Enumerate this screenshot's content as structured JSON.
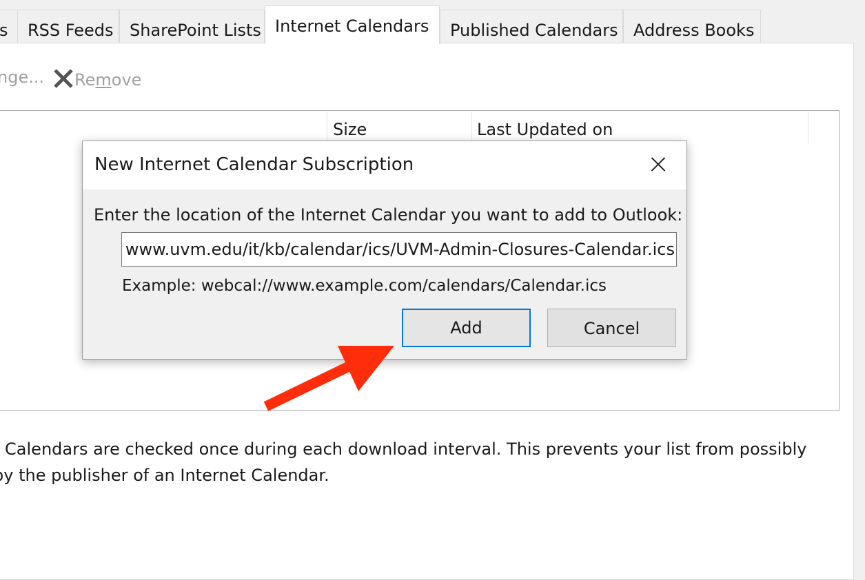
{
  "tabs": [
    {
      "label": "s"
    },
    {
      "label": "RSS Feeds"
    },
    {
      "label": "SharePoint Lists"
    },
    {
      "label": "Internet Calendars"
    },
    {
      "label": "Published Calendars"
    },
    {
      "label": "Address Books"
    }
  ],
  "toolbar": {
    "change_label": "nge...",
    "remove_label_pre": "Re",
    "remove_label_u": "m",
    "remove_label_post": "ove",
    "remove_icon": "x-icon"
  },
  "list": {
    "columns": [
      "Size",
      "Last Updated on"
    ]
  },
  "info_text": {
    "line1": "t Calendars are checked once during each download interval. This prevents your list from possibly",
    "line2": "by the publisher of an Internet Calendar."
  },
  "dialog": {
    "title": "New Internet Calendar Subscription",
    "prompt": "Enter the location of the Internet Calendar you want to add to Outlook:",
    "input_value": "www.uvm.edu/it/kb/calendar/ics/UVM-Admin-Closures-Calendar.ics",
    "example": "Example: webcal://www.example.com/calendars/Calendar.ics",
    "add_label": "Add",
    "cancel_label": "Cancel"
  },
  "annotation": {
    "color": "#ff2d0a"
  }
}
